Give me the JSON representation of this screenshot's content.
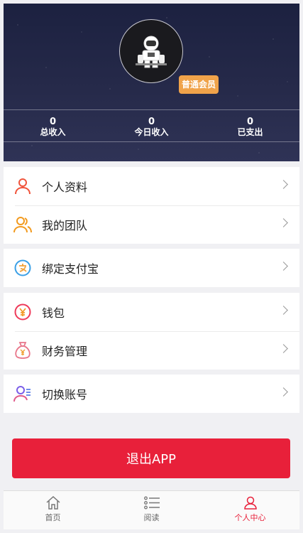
{
  "profile": {
    "member_badge": "普通会员",
    "stats": [
      {
        "value": "0",
        "label": "总收入"
      },
      {
        "value": "0",
        "label": "今日收入"
      },
      {
        "value": "0",
        "label": "已支出"
      }
    ]
  },
  "menu": {
    "profile_info": "个人资料",
    "my_team": "我的团队",
    "bind_alipay": "绑定支付宝",
    "wallet": "钱包",
    "finance": "财务管理",
    "switch_account": "切换账号"
  },
  "logout_label": "退出APP",
  "tabbar": {
    "home": "首页",
    "read": "阅读",
    "me": "个人中心",
    "active": "me"
  },
  "colors": {
    "accent": "#e8203a",
    "badge": "#f0a34a",
    "header_bg": "#262a4a"
  }
}
